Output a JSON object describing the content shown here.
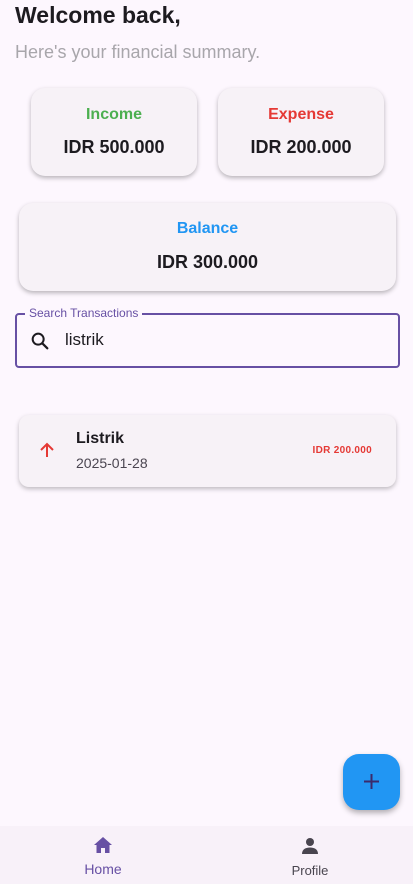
{
  "header": {
    "greeting": "Welcome back,",
    "subtitle": "Here's your financial summary."
  },
  "summary": {
    "income": {
      "label": "Income",
      "amount": "IDR 500.000",
      "color": "#4caf50"
    },
    "expense": {
      "label": "Expense",
      "amount": "IDR 200.000",
      "color": "#e53935"
    },
    "balance": {
      "label": "Balance",
      "amount": "IDR 300.000",
      "color": "#2196f3"
    }
  },
  "search": {
    "label": "Search Transactions",
    "value": "listrik",
    "icon": "search-icon"
  },
  "transactions": [
    {
      "title": "Listrik",
      "date": "2025-01-28",
      "amount": "IDR 200.000",
      "type": "expense",
      "icon": "arrow-up-icon"
    }
  ],
  "fab": {
    "icon": "add-icon",
    "color": "#2196f3"
  },
  "bottom_nav": {
    "items": [
      {
        "label": "Home",
        "icon": "home-icon",
        "active": true
      },
      {
        "label": "Profile",
        "icon": "person-icon",
        "active": false
      }
    ]
  }
}
